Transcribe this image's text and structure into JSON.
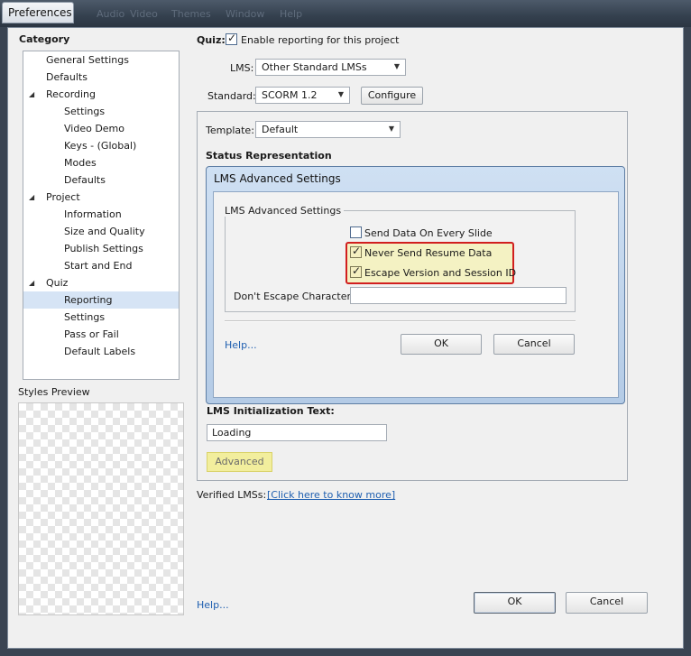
{
  "window": {
    "title": "Preferences",
    "ghost_menu": [
      "Audio",
      "Video",
      "Themes",
      "Window",
      "Help"
    ]
  },
  "category": {
    "label": "Category",
    "items": [
      {
        "label": "General Settings",
        "level": 1,
        "arrow": false,
        "selected": false
      },
      {
        "label": "Defaults",
        "level": 1,
        "arrow": false,
        "selected": false
      },
      {
        "label": "Recording",
        "level": 1,
        "arrow": true,
        "selected": false
      },
      {
        "label": "Settings",
        "level": 2,
        "arrow": false,
        "selected": false
      },
      {
        "label": "Video Demo",
        "level": 2,
        "arrow": false,
        "selected": false
      },
      {
        "label": "Keys - (Global)",
        "level": 2,
        "arrow": false,
        "selected": false
      },
      {
        "label": "Modes",
        "level": 2,
        "arrow": false,
        "selected": false
      },
      {
        "label": "Defaults",
        "level": 2,
        "arrow": false,
        "selected": false
      },
      {
        "label": "Project",
        "level": 1,
        "arrow": true,
        "selected": false
      },
      {
        "label": "Information",
        "level": 2,
        "arrow": false,
        "selected": false
      },
      {
        "label": "Size and Quality",
        "level": 2,
        "arrow": false,
        "selected": false
      },
      {
        "label": "Publish Settings",
        "level": 2,
        "arrow": false,
        "selected": false
      },
      {
        "label": "Start and End",
        "level": 2,
        "arrow": false,
        "selected": false
      },
      {
        "label": "Quiz",
        "level": 1,
        "arrow": true,
        "selected": false
      },
      {
        "label": "Reporting",
        "level": 2,
        "arrow": false,
        "selected": true
      },
      {
        "label": "Settings",
        "level": 2,
        "arrow": false,
        "selected": false
      },
      {
        "label": "Pass or Fail",
        "level": 2,
        "arrow": false,
        "selected": false
      },
      {
        "label": "Default Labels",
        "level": 2,
        "arrow": false,
        "selected": false
      }
    ]
  },
  "styles_preview": {
    "label": "Styles Preview"
  },
  "quiz": {
    "label": "Quiz:",
    "enable_reporting_label": "Enable reporting for this project",
    "enable_reporting_checked": true,
    "lms_label": "LMS:",
    "lms_value": "Other Standard LMSs",
    "standard_label": "Standard:",
    "standard_value": "SCORM 1.2",
    "configure_label": "Configure",
    "template_label": "Template:",
    "template_value": "Default",
    "status_representation_label": "Status Representation",
    "lms_init_text_label": "LMS Initialization Text:",
    "lms_init_text_value": "Loading",
    "advanced_label": "Advanced",
    "verified_lms_label": "Verified LMSs:",
    "verified_lms_link": "[Click here to know more]"
  },
  "modal": {
    "title": "LMS Advanced Settings",
    "group_label": "LMS Advanced Settings",
    "send_data_label": "Send Data On Every Slide",
    "send_data_checked": false,
    "never_send_resume_label": "Never Send Resume Data",
    "never_send_resume_checked": true,
    "escape_version_label": "Escape Version and Session ID",
    "escape_version_checked": true,
    "dont_escape_label": "Don't Escape Characters:",
    "dont_escape_value": "",
    "help_label": "Help...",
    "ok_label": "OK",
    "cancel_label": "Cancel"
  },
  "footer": {
    "help_label": "Help...",
    "ok_label": "OK",
    "cancel_label": "Cancel"
  }
}
